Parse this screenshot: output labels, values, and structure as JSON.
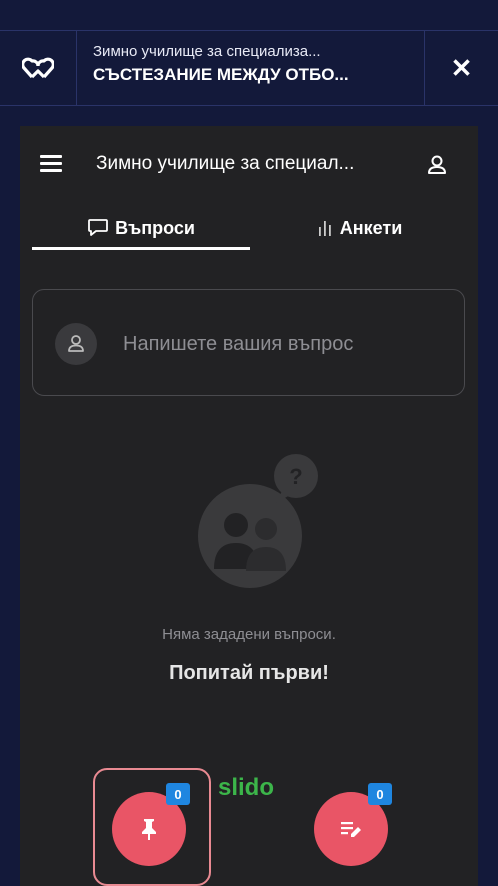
{
  "topbar": {
    "subtitle": "Зимно училище за специализа...",
    "title": "СЪСТЕЗАНИЕ МЕЖДУ ОТБО...",
    "close_label": "✕"
  },
  "panel": {
    "title": "Зимно училище за специал...",
    "tabs": [
      {
        "label": "Въпроси",
        "active": true
      },
      {
        "label": "Анкети",
        "active": false
      }
    ],
    "ask_placeholder": "Напишете вашия въпрос",
    "empty_text": "Няма зададени въпроси.",
    "empty_cta": "Попитай първи!",
    "brand": "slido",
    "fab_pin_count": "0",
    "fab_notes_count": "0"
  },
  "colors": {
    "background": "#13193a",
    "panel": "#222224",
    "accent": "#e95566",
    "badge": "#1f86e0",
    "slido": "#3cb54a"
  }
}
